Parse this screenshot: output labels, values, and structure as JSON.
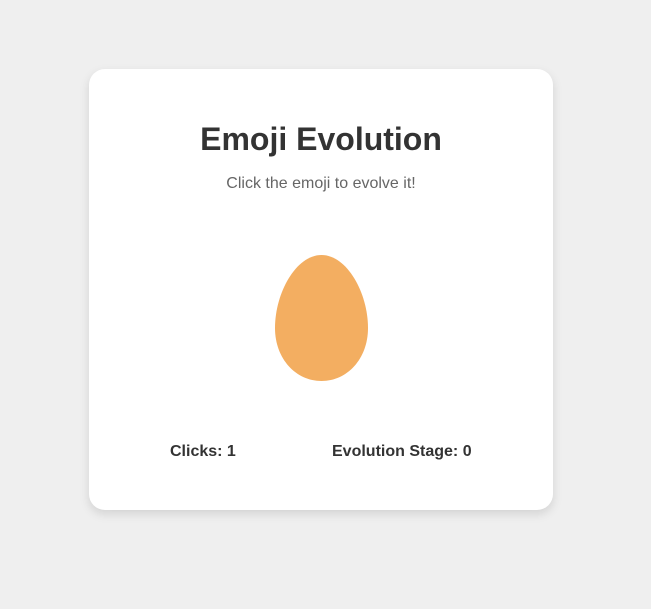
{
  "title": "Emoji Evolution",
  "subtitle": "Click the emoji to evolve it!",
  "emoji": {
    "icon": "egg-icon",
    "color": "#f3ae61"
  },
  "stats": {
    "clicks_label": "Clicks:",
    "clicks_value": "1",
    "stage_label": "Evolution Stage:",
    "stage_value": "0"
  }
}
